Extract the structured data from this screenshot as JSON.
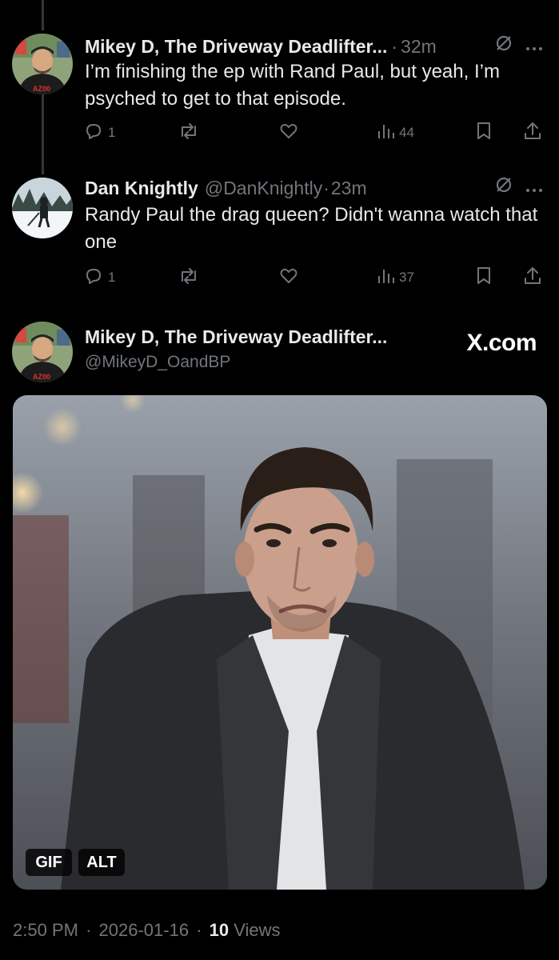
{
  "thread": [
    {
      "name": "Mikey D, The Driveway Deadlifter...",
      "handle": "",
      "time": "32m",
      "text": "I’m finishing the ep with Rand Paul, but yeah, I’m psyched to get to that episode.",
      "replies": "1",
      "views": "44"
    },
    {
      "name": "Dan Knightly",
      "handle": "@DanKnightly",
      "time": "23m",
      "text": "Randy Paul the drag queen? Didn't wanna watch that one",
      "replies": "1",
      "views": "37"
    }
  ],
  "quote": {
    "name": "Mikey D, The Driveway Deadlifter...",
    "handle": "@MikeyD_OandBP",
    "brand": "X.com",
    "gif_label": "GIF",
    "alt_label": "ALT"
  },
  "footer": {
    "time": "2:50 PM",
    "date": "2026-01-16",
    "views_count": "10",
    "views_label": "Views"
  },
  "separator": "·",
  "icons": {
    "reply": "reply-icon",
    "repost": "repost-icon",
    "like": "heart-icon",
    "views": "analytics-icon",
    "bookmark": "bookmark-icon",
    "share": "share-icon",
    "grok": "slash-circle-icon",
    "more": "more-icon"
  },
  "colors": {
    "background": "#000000",
    "text": "#e7e9ea",
    "muted": "#71767b"
  }
}
